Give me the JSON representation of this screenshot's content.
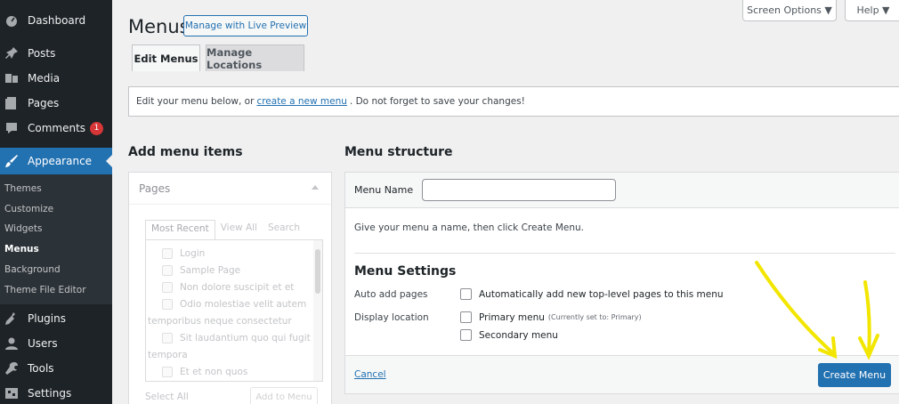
{
  "sidebar": {
    "items": [
      {
        "label": "Dashboard",
        "icon": "dashboard-icon"
      },
      {
        "label": "Posts",
        "icon": "pin-icon"
      },
      {
        "label": "Media",
        "icon": "media-icon"
      },
      {
        "label": "Pages",
        "icon": "pages-icon"
      },
      {
        "label": "Comments",
        "icon": "comment-icon",
        "badge": "1"
      },
      {
        "label": "Appearance",
        "icon": "brush-icon",
        "active": true
      },
      {
        "label": "Plugins",
        "icon": "plug-icon"
      },
      {
        "label": "Users",
        "icon": "user-icon"
      },
      {
        "label": "Tools",
        "icon": "wrench-icon"
      },
      {
        "label": "Settings",
        "icon": "settings-icon"
      }
    ],
    "submenu": [
      "Themes",
      "Customize",
      "Widgets",
      "Menus",
      "Background",
      "Theme File Editor"
    ],
    "current_sub": "Menus"
  },
  "header": {
    "title": "Menus",
    "live_preview": "Manage with Live Preview",
    "screen_options": "Screen Options ▼",
    "help": "Help ▼"
  },
  "tabs": [
    "Edit Menus",
    "Manage Locations"
  ],
  "notice": {
    "before": "Edit your menu below, or",
    "link": "create a new menu",
    "after": ". Do not forget to save your changes!"
  },
  "add_items": {
    "title": "Add menu items",
    "section": "Pages",
    "tabs": [
      "Most Recent",
      "View All",
      "Search"
    ],
    "pages": [
      "Login",
      "Sample Page",
      "Non dolore suscipit et et",
      "Odio molestiae velit autem",
      "temporibus neque consectetur",
      "Sit laudantium quo qui fugit",
      "tempora",
      "Et et non quos"
    ],
    "select_all": "Select All",
    "add_to_menu": "Add to Menu"
  },
  "structure": {
    "title": "Menu structure",
    "menu_name_label": "Menu Name",
    "menu_name_value": "",
    "hint": "Give your menu a name, then click Create Menu.",
    "settings_title": "Menu Settings",
    "auto_add_label": "Auto add pages",
    "auto_add_option": "Automatically add new top-level pages to this menu",
    "display_location_label": "Display location",
    "primary_menu": "Primary menu",
    "primary_note": "(Currently set to: Primary)",
    "secondary_menu": "Secondary menu",
    "cancel": "Cancel",
    "create": "Create Menu"
  },
  "colors": {
    "accent": "#2271b1",
    "sidebar": "#1d2327",
    "annotation": "#f2e600"
  }
}
